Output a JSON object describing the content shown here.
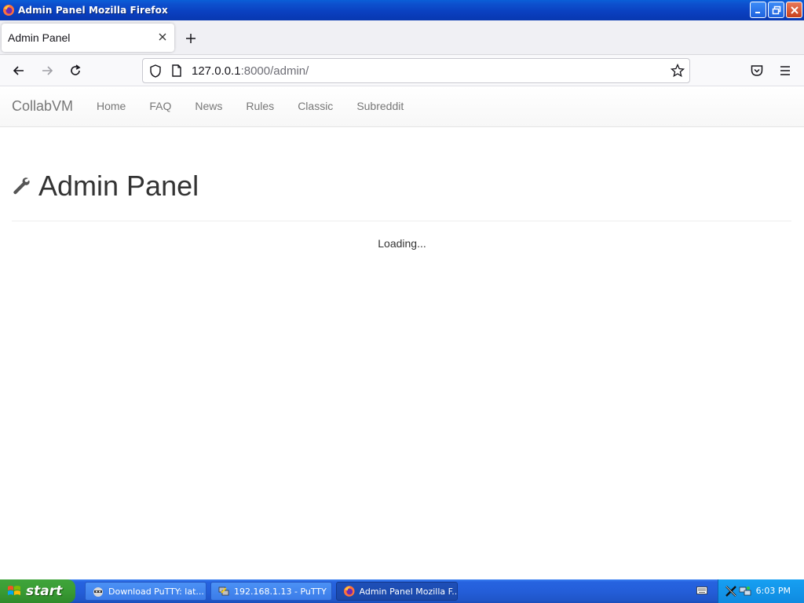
{
  "window": {
    "title": "Admin Panel  Mozilla Firefox"
  },
  "browser": {
    "tab_title": "Admin Panel",
    "url_host": "127.0.0.1",
    "url_rest": ":8000/admin/"
  },
  "site": {
    "brand": "CollabVM",
    "nav": [
      "Home",
      "FAQ",
      "News",
      "Rules",
      "Classic",
      "Subreddit"
    ]
  },
  "page": {
    "heading": "Admin Panel",
    "status": "Loading..."
  },
  "taskbar": {
    "start_label": "start",
    "tasks": [
      {
        "label": "Download PuTTY: lat..."
      },
      {
        "label": "192.168.1.13 - PuTTY"
      },
      {
        "label": "Admin Panel  Mozilla F..."
      }
    ],
    "clock": "6:03 PM"
  },
  "colors": {
    "titlebar": "#0a3fbf",
    "taskbar": "#245ed9",
    "start": "#3b9e36",
    "tray": "#0f8ae0"
  }
}
